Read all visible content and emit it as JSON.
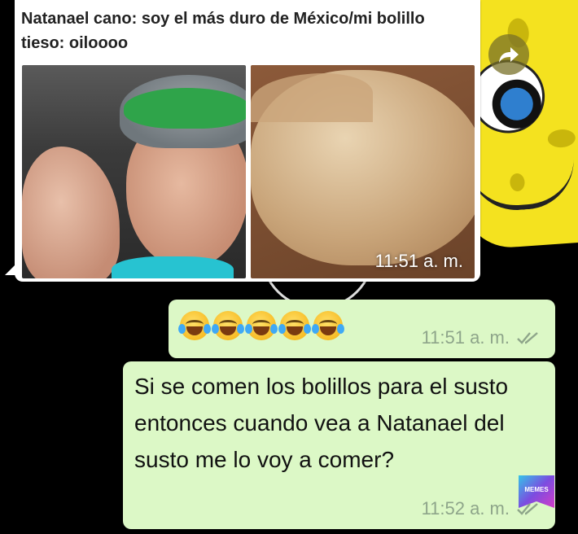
{
  "incoming": {
    "caption": "Natanael cano: soy el más duro de México/mi bolillo tieso: oiloooo",
    "photo_time": "11:51 a. m."
  },
  "outgoing1": {
    "emojis": [
      "face-with-tears-of-joy",
      "face-with-tears-of-joy",
      "face-with-tears-of-joy",
      "face-with-tears-of-joy",
      "face-with-tears-of-joy"
    ],
    "time": "11:51 a. m."
  },
  "outgoing2": {
    "text": "Si se comen los bolillos para el susto entonces cuando vea a Natanael del susto me lo voy a comer?",
    "time": "11:52 a. m."
  },
  "watermark": {
    "label": "MEMES"
  },
  "icons": {
    "forward": "forward-arrow-icon",
    "read_receipt": "double-check-icon"
  },
  "colors": {
    "outgoing_bubble": "#dcf8c6",
    "incoming_bubble": "#ffffff",
    "receipt": "#8ea58a",
    "forward_button": "#787028"
  }
}
